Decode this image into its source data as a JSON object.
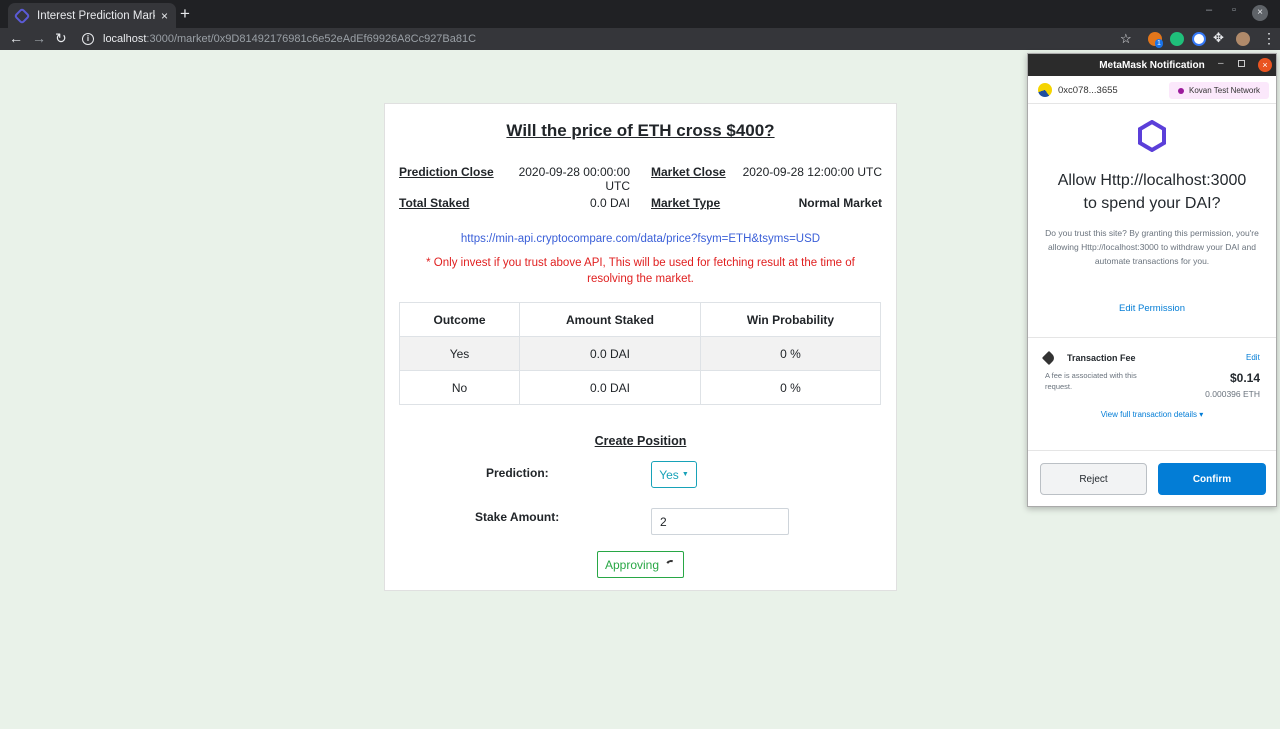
{
  "browser": {
    "tab_title": "Interest Prediction Marke",
    "tab_close": "×",
    "new_tab": "+",
    "url_host": "localhost",
    "url_rest": ":3000/market/0x9D81492176981c6e52eAdEf69926A8Cc927Ba81C",
    "win_minimize": "–",
    "win_restore": "▫",
    "win_close": "×",
    "back_icon": "←",
    "forward_icon": "→",
    "reload_icon": "↻",
    "star_icon": "☆",
    "puzzle_icon": "✥",
    "menu_icon": "⋮",
    "info_icon": "i",
    "ext_badge": "1"
  },
  "market": {
    "question": "Will the price of ETH cross $400?",
    "prediction_close_label": "Prediction Close",
    "prediction_close_value": "2020-09-28 00:00:00 UTC",
    "market_close_label": "Market Close",
    "market_close_value": "2020-09-28 12:00:00 UTC",
    "total_staked_label": "Total Staked",
    "total_staked_value": "0.0 DAI",
    "market_type_label": "Market Type",
    "market_type_value": "Normal Market",
    "api_url": "https://min-api.cryptocompare.com/data/price?fsym=ETH&tsyms=USD",
    "warning": "* Only invest if you trust above API, This will be used for fetching result at the time of resolving the market."
  },
  "table": {
    "headers": [
      "Outcome",
      "Amount Staked",
      "Win Probability"
    ],
    "rows": [
      [
        "Yes",
        "0.0 DAI",
        "0 %"
      ],
      [
        "No",
        "0.0 DAI",
        "0 %"
      ]
    ]
  },
  "position": {
    "title": "Create Position",
    "prediction_label": "Prediction:",
    "prediction_value": "Yes",
    "stake_label": "Stake Amount:",
    "stake_value": "2",
    "approve_label": "Approving"
  },
  "metamask": {
    "title": "MetaMask Notification",
    "minimize": "–",
    "close": "×",
    "account": "0xc078...3655",
    "network": "Kovan Test Network",
    "allow_line1": "Allow Http://localhost:3000",
    "allow_line2": "to spend your DAI?",
    "description": "Do you trust this site? By granting this permission, you're allowing Http://localhost:3000 to withdraw your DAI and automate transactions for you.",
    "edit_permission": "Edit Permission",
    "fee_label": "Transaction Fee",
    "fee_edit": "Edit",
    "fee_note": "A fee is associated with this request.",
    "fee_usd": "$0.14",
    "fee_eth": "0.000396 ETH",
    "view_details": "View full transaction details ▾",
    "reject": "Reject",
    "confirm": "Confirm"
  },
  "colors": {
    "page_bg": "#e9f2e9",
    "link_blue": "#3a5fd8",
    "warning_red": "#e02020",
    "info_teal": "#17a2b8",
    "success_green": "#28a745",
    "metamask_blue": "#037dd6",
    "metamask_logo": "#5b3fd9"
  }
}
